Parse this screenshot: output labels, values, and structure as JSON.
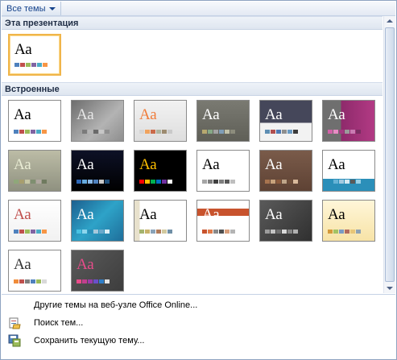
{
  "header": {
    "dropdown_label": "Все темы"
  },
  "sections": {
    "this_presentation": "Эта презентация",
    "builtin": "Встроенные"
  },
  "thumb_text": "Aa",
  "current_theme": {
    "label": "Aa",
    "bg": "#ffffff",
    "fg": "#000000",
    "swatches": [
      "#4f81bd",
      "#c0504d",
      "#9bbb59",
      "#8064a2",
      "#4bacc6",
      "#f79646"
    ]
  },
  "themes": [
    {
      "bg": "#ffffff",
      "fg": "#000000",
      "swatches": [
        "#4f81bd",
        "#c0504d",
        "#9bbb59",
        "#8064a2",
        "#4bacc6",
        "#f79646"
      ]
    },
    {
      "bg": "linear-gradient(135deg,#6e6e6e,#b3b3b3 60%,#8e8e8e)",
      "fg": "#e8e8e8",
      "swatches": [
        "#9e9e9e",
        "#7b7b7b",
        "#b4b4b4",
        "#6a6a6a",
        "#c7c7c7",
        "#8f8f8f"
      ]
    },
    {
      "bg": "linear-gradient(#f2f2f2,#dedede)",
      "fg": "#f07c3a",
      "swatches": [
        "#d6d6d6",
        "#f0a35e",
        "#ca6b4a",
        "#aeb4a0",
        "#9d8b70",
        "#c9c9c9"
      ]
    },
    {
      "bg": "linear-gradient(#7a7a72,#5f5f57)",
      "fg": "#ffffff",
      "swatches": [
        "#b7a86f",
        "#86a886",
        "#a2a2a2",
        "#7f9db6",
        "#c1c1a8",
        "#8c8c7c"
      ]
    },
    {
      "bg": "linear-gradient(#45475a 0%,#45475a 55%,#f2f2f2 55%)",
      "fg": "#ffffff",
      "swatches": [
        "#5e8eb3",
        "#b14f4f",
        "#4f7ab3",
        "#8f8f8f",
        "#6a9bc3",
        "#3c3c3c"
      ]
    },
    {
      "bg": "linear-gradient(90deg,#6f6f6f 0%,#6f6f6f 35%,#8e2a6b 35%,#b23a84)",
      "fg": "#ffffff",
      "swatches": [
        "#d262a8",
        "#e78bc4",
        "#a43b82",
        "#9b9b9b",
        "#c97bb2",
        "#7a2d62"
      ]
    },
    {
      "bg": "linear-gradient(#bcbca6,#8f9180)",
      "fg": "#e9ecd4",
      "swatches": [
        "#8fa77a",
        "#a79e6e",
        "#c7c7a5",
        "#7f8f70",
        "#b0a7a0",
        "#6f7a5f"
      ]
    },
    {
      "bg": "linear-gradient(#0d1126,#000000)",
      "fg": "#ffffff",
      "swatches": [
        "#2d67b6",
        "#65a9dd",
        "#89b8e6",
        "#4f81bd",
        "#c9c9c9",
        "#1f4e79"
      ]
    },
    {
      "bg": "#000000",
      "fg": "#ffc000",
      "swatches": [
        "#ff0000",
        "#ffc000",
        "#00b050",
        "#0070c0",
        "#7030a0",
        "#ffffff"
      ]
    },
    {
      "bg": "#ffffff",
      "fg": "#000000",
      "swatches": [
        "#a6a6a6",
        "#7f7f7f",
        "#404040",
        "#7e7e7e",
        "#595959",
        "#bfbfbf"
      ]
    },
    {
      "bg": "linear-gradient(#7a5b4a,#5e4234)",
      "fg": "#ffffff",
      "swatches": [
        "#a8744f",
        "#c8a37c",
        "#8b5a3c",
        "#bfa589",
        "#6f4f3a",
        "#d9b99b"
      ]
    },
    {
      "bg": "linear-gradient(#ffffff 0%,#ffffff 70%,#2b8fb9 70%)",
      "fg": "#000000",
      "swatches": [
        "#2b8fb9",
        "#66b3d6",
        "#a3c9e0",
        "#d6e8f2",
        "#5a5a5a",
        "#9bd0e6"
      ]
    },
    {
      "bg": "linear-gradient(#ffffff,#f1f1f1)",
      "fg": "#c0504d",
      "swatches": [
        "#4f81bd",
        "#c0504d",
        "#9bbb59",
        "#8064a2",
        "#4bacc6",
        "#f79646"
      ]
    },
    {
      "bg": "linear-gradient(135deg,#1c5f8f,#2ea3c8 50%,#1f6e9a)",
      "fg": "#ffffff",
      "swatches": [
        "#48c2e3",
        "#8cd6ed",
        "#2b8fb9",
        "#a6c8db",
        "#69a9cc",
        "#dbeef6"
      ]
    },
    {
      "bg": "linear-gradient(90deg,#e8e1cc 0%,#e8e1cc 10%,#ffffff 10%)",
      "fg": "#000000",
      "swatches": [
        "#a4b36e",
        "#c8b26b",
        "#8aa3b8",
        "#b07b5a",
        "#d2c99f",
        "#6f8fa6"
      ]
    },
    {
      "bg": "linear-gradient(#ffffff 0%,#ffffff 20%,#c8532d 20%,#c8532d 38%,#ffffff 38%)",
      "fg": "#ffffff",
      "swatches": [
        "#c8532d",
        "#e07b4a",
        "#8a8a8a",
        "#4f4f4f",
        "#d89f7c",
        "#b4b4b4"
      ]
    },
    {
      "bg": "linear-gradient(135deg,#5a5a5a,#303030)",
      "fg": "#ffffff",
      "swatches": [
        "#9c9c9c",
        "#c3c3c3",
        "#707070",
        "#d8d8d8",
        "#858585",
        "#b0b0b0"
      ]
    },
    {
      "bg": "linear-gradient(#fff6d9,#f7e3a7)",
      "fg": "#000000",
      "swatches": [
        "#d49a3a",
        "#a4c364",
        "#7a9bc4",
        "#b26a5d",
        "#e8c677",
        "#8fa3b3"
      ]
    },
    {
      "bg": "#ffffff",
      "fg": "#333333",
      "swatches": [
        "#f08c3a",
        "#c0504d",
        "#7f7f7f",
        "#4f81bd",
        "#9bbb59",
        "#d9d9d9"
      ]
    },
    {
      "bg": "linear-gradient(135deg,#5a5a5a,#3d3d3d)",
      "fg": "#e84c8a",
      "swatches": [
        "#e84c8a",
        "#c23f8d",
        "#9a3aa8",
        "#6a4fc9",
        "#2f7fc8",
        "#e5e5e5"
      ]
    }
  ],
  "menu": [
    {
      "label": "Другие темы на веб-узле Office Online...",
      "icon": "blank-icon"
    },
    {
      "label": "Поиск тем...",
      "icon": "browse-folder-icon"
    },
    {
      "label": "Сохранить текущую тему...",
      "icon": "save-theme-icon"
    }
  ]
}
